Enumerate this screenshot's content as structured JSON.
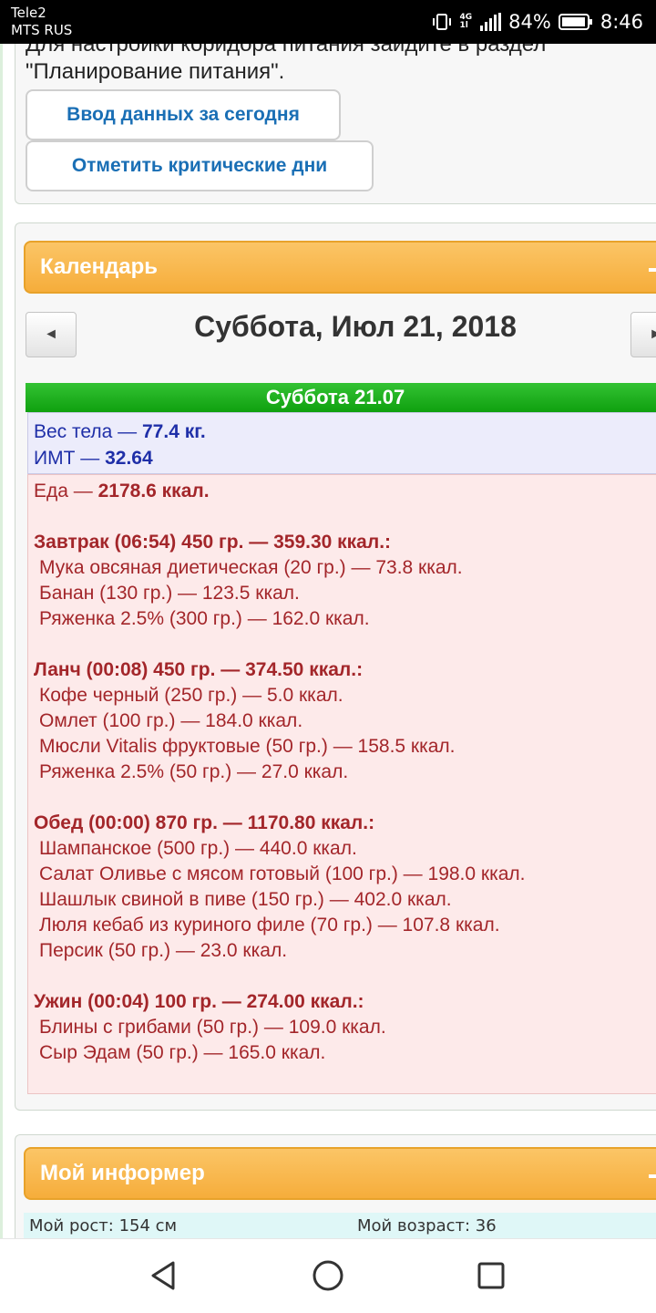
{
  "status_bar": {
    "carrier_1": "Tele2",
    "carrier_2": "MTS RUS",
    "network_top": "4G",
    "network_bottom": "1l",
    "battery": "84%",
    "time": "8:46",
    "icons": [
      "vibrate-icon",
      "signal-icon",
      "battery-icon"
    ]
  },
  "top_card": {
    "note_line1": "Для настройки коридора питания зайдите в раздел",
    "note_line2": "\"Планирование питания\".",
    "button_enter_today": "Ввод данных за сегодня",
    "button_mark_critical": "Отметить критические дни"
  },
  "calendar": {
    "section_title": "Календарь",
    "prev_symbol": "◄",
    "next_symbol": "►",
    "date_title": "Суббота, Июл 21, 2018",
    "day_header": "Суббота 21.07",
    "weight_label": "Вес тела — ",
    "weight_value": "77.4 кг.",
    "bmi_label": "ИМТ — ",
    "bmi_value": "32.64",
    "food_label": "Еда — ",
    "food_value": "2178.6 ккал.",
    "meals": [
      {
        "title": "Завтрак (06:54) 450 гр. — 359.30 ккал.:",
        "items": [
          "Мука овсяная диетическая (20 гр.) — 73.8 ккал.",
          "Банан (130 гр.) — 123.5 ккал.",
          "Ряженка 2.5% (300 гр.) — 162.0 ккал."
        ]
      },
      {
        "title": "Ланч (00:08) 450 гр. — 374.50 ккал.:",
        "items": [
          "Кофе черный (250 гр.) — 5.0 ккал.",
          "Омлет (100 гр.) — 184.0 ккал.",
          "Мюсли Vitalis фруктовые (50 гр.) — 158.5 ккал.",
          "Ряженка 2.5% (50 гр.) — 27.0 ккал."
        ]
      },
      {
        "title": "Обед (00:00) 870 гр. — 1170.80 ккал.:",
        "items": [
          "Шампанское (500 гр.) — 440.0 ккал.",
          "Салат Оливье с мясом готовый (100 гр.) — 198.0 ккал.",
          "Шашлык свиной в пиве (150 гр.) — 402.0 ккал.",
          "Люля кебаб из куриного филе (70 гр.) — 107.8 ккал.",
          "Персик (50 гр.) — 23.0 ккал."
        ]
      },
      {
        "title": "Ужин (00:04) 100 гр. — 274.00 ккал.:",
        "items": [
          "Блины с грибами (50 гр.) — 109.0 ккал.",
          "Сыр Эдам (50 гр.) — 165.0 ккал."
        ]
      }
    ]
  },
  "informer": {
    "section_title": "Мой информер",
    "height": "Мой рост: 154 см",
    "age": "Мой возраст: 36"
  },
  "colors": {
    "orange_header": "#f6ad3b",
    "green_header": "#1aa81a",
    "button_text": "#1a6fb5",
    "food_text": "#a3262a",
    "weight_text": "#1f2fa8"
  }
}
